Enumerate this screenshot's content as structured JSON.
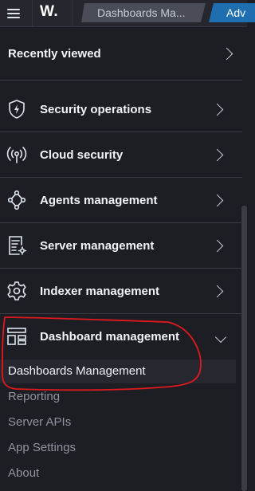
{
  "topbar": {
    "logo": "W.",
    "breadcrumb": "Dashboards Ma...",
    "app_button": "Adv"
  },
  "nav": {
    "recently_viewed": "Recently viewed",
    "items": [
      {
        "label": "Security operations",
        "icon": "shield-icon"
      },
      {
        "label": "Cloud security",
        "icon": "broadcast-icon"
      },
      {
        "label": "Agents management",
        "icon": "agents-network-icon"
      },
      {
        "label": "Server management",
        "icon": "server-document-gear-icon"
      },
      {
        "label": "Indexer management",
        "icon": "gear-icon"
      },
      {
        "label": "Dashboard management",
        "icon": "dashboard-layout-icon",
        "expanded": true
      }
    ],
    "subitems": [
      "Dashboards Management",
      "Reporting",
      "Server APIs",
      "App Settings",
      "About"
    ]
  },
  "annotation": {
    "color": "#e0191c"
  },
  "colors": {
    "accent": "#1f6fb0",
    "background": "#1d1e24"
  }
}
